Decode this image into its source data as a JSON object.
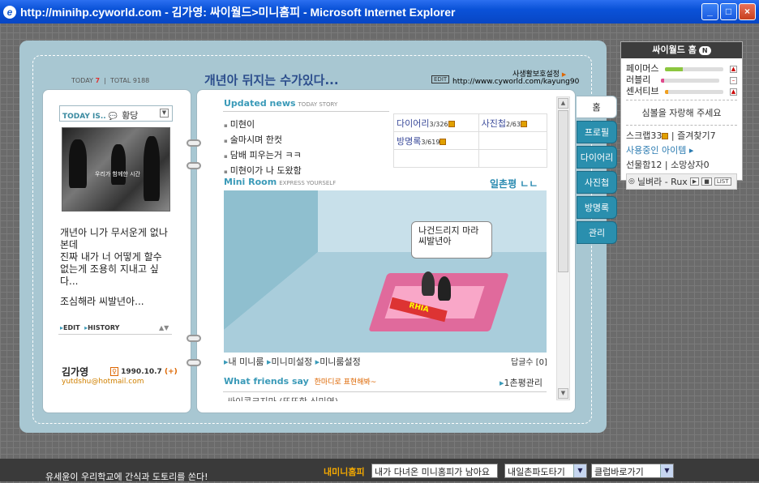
{
  "window": {
    "title": "http://minihp.cyworld.com - 김가영: 싸이월드>미니홈피 - Microsoft Internet Explorer",
    "minimize": "_",
    "maximize": "□",
    "close": "×"
  },
  "header": {
    "today_label": "TODAY",
    "today_count": "7",
    "total_label": "TOTAL",
    "total_count": "9188",
    "headline": "개년아 뒤지는 수가있다...",
    "edit_label": "EDIT",
    "privacy_link": "사생활보호설정",
    "url": "http://www.cyworld.com/kayung90"
  },
  "profile": {
    "today_is_label": "TODAY IS..",
    "mood": "황당",
    "photo_caption": "우리가 함께한 시간",
    "bio": "개년아 니가 무서운게 없나본데\n진짜 내가 너 어떻게 할수 없는게 조용히 지내고 싶다...",
    "bio2": "조심해라 씨발년아...",
    "edit_link": "EDIT",
    "history_link": "HISTORY",
    "name": "김가영",
    "gender_icon": "female-icon",
    "birth": "1990.10.7",
    "birth_extra": "(+)",
    "email": "yutdshu@hotmail.com"
  },
  "updated": {
    "title": "Updated news",
    "subtitle": "TODAY STORY",
    "items": [
      "미현이",
      "술마시며 한컷",
      "담배 피우는거 ㅋㅋ",
      "미현이가 나 도왔함"
    ]
  },
  "stats": {
    "diary_label": "다이어리",
    "diary_count": "3/326",
    "photo_label": "사진첩",
    "photo_count": "2/63",
    "guest_label": "방명록",
    "guest_count": "3/619"
  },
  "miniroom": {
    "title": "Mini Room",
    "subtitle": "EXPRESS YOURSELF",
    "ilchon_label": "일촌평 ㄴㄴ",
    "bubble": "나건드리지 마라 씨발년아",
    "bed_sign": "RHIA",
    "links": [
      "내 미니룸",
      "미니미설정",
      "미니룸설정"
    ],
    "replies": "답글수 [0]"
  },
  "friends": {
    "title": "What friends say",
    "subtitle": "한마디로 표현해봐~",
    "manage": "1촌평관리",
    "first_entry": "싸이콘크지마 (또또한 신미연)"
  },
  "tabs": [
    "홈",
    "프로필",
    "다이어리",
    "사진첩",
    "방명록",
    "관리"
  ],
  "cyworld_panel": {
    "title": "싸이월드 홈",
    "badge": "N",
    "meters": [
      {
        "label": "페이머스",
        "value": 0.3,
        "color": "#8cc63f",
        "trend": "up"
      },
      {
        "label": "러블리",
        "value": 0.05,
        "color": "#e04a8c",
        "trend": "flat"
      },
      {
        "label": "센서티브",
        "value": 0.05,
        "color": "#f0a020",
        "trend": "up"
      }
    ],
    "notice": "심볼을 자랑해 주세요",
    "scrap_label": "스크랩",
    "scrap_count": "33",
    "favorites_label": "즐겨찾기",
    "favorites_count": "7",
    "items_label": "사용중인 아이템",
    "gift_label": "선물함",
    "gift_count": "12",
    "wish_label": "소망상자",
    "wish_count": "0",
    "bgm": "닐벼라 - Rux",
    "list_label": "LIST"
  },
  "bottom": {
    "marquee": "유세윤이 우리학교에 간식과 도토리를 쏜다!",
    "minihp_label": "내미니홈피",
    "visited_box": "내가 다녀온 미니홈피가 남아요",
    "select1": "내일촌파도타기",
    "select2": "클럽바로가기"
  }
}
